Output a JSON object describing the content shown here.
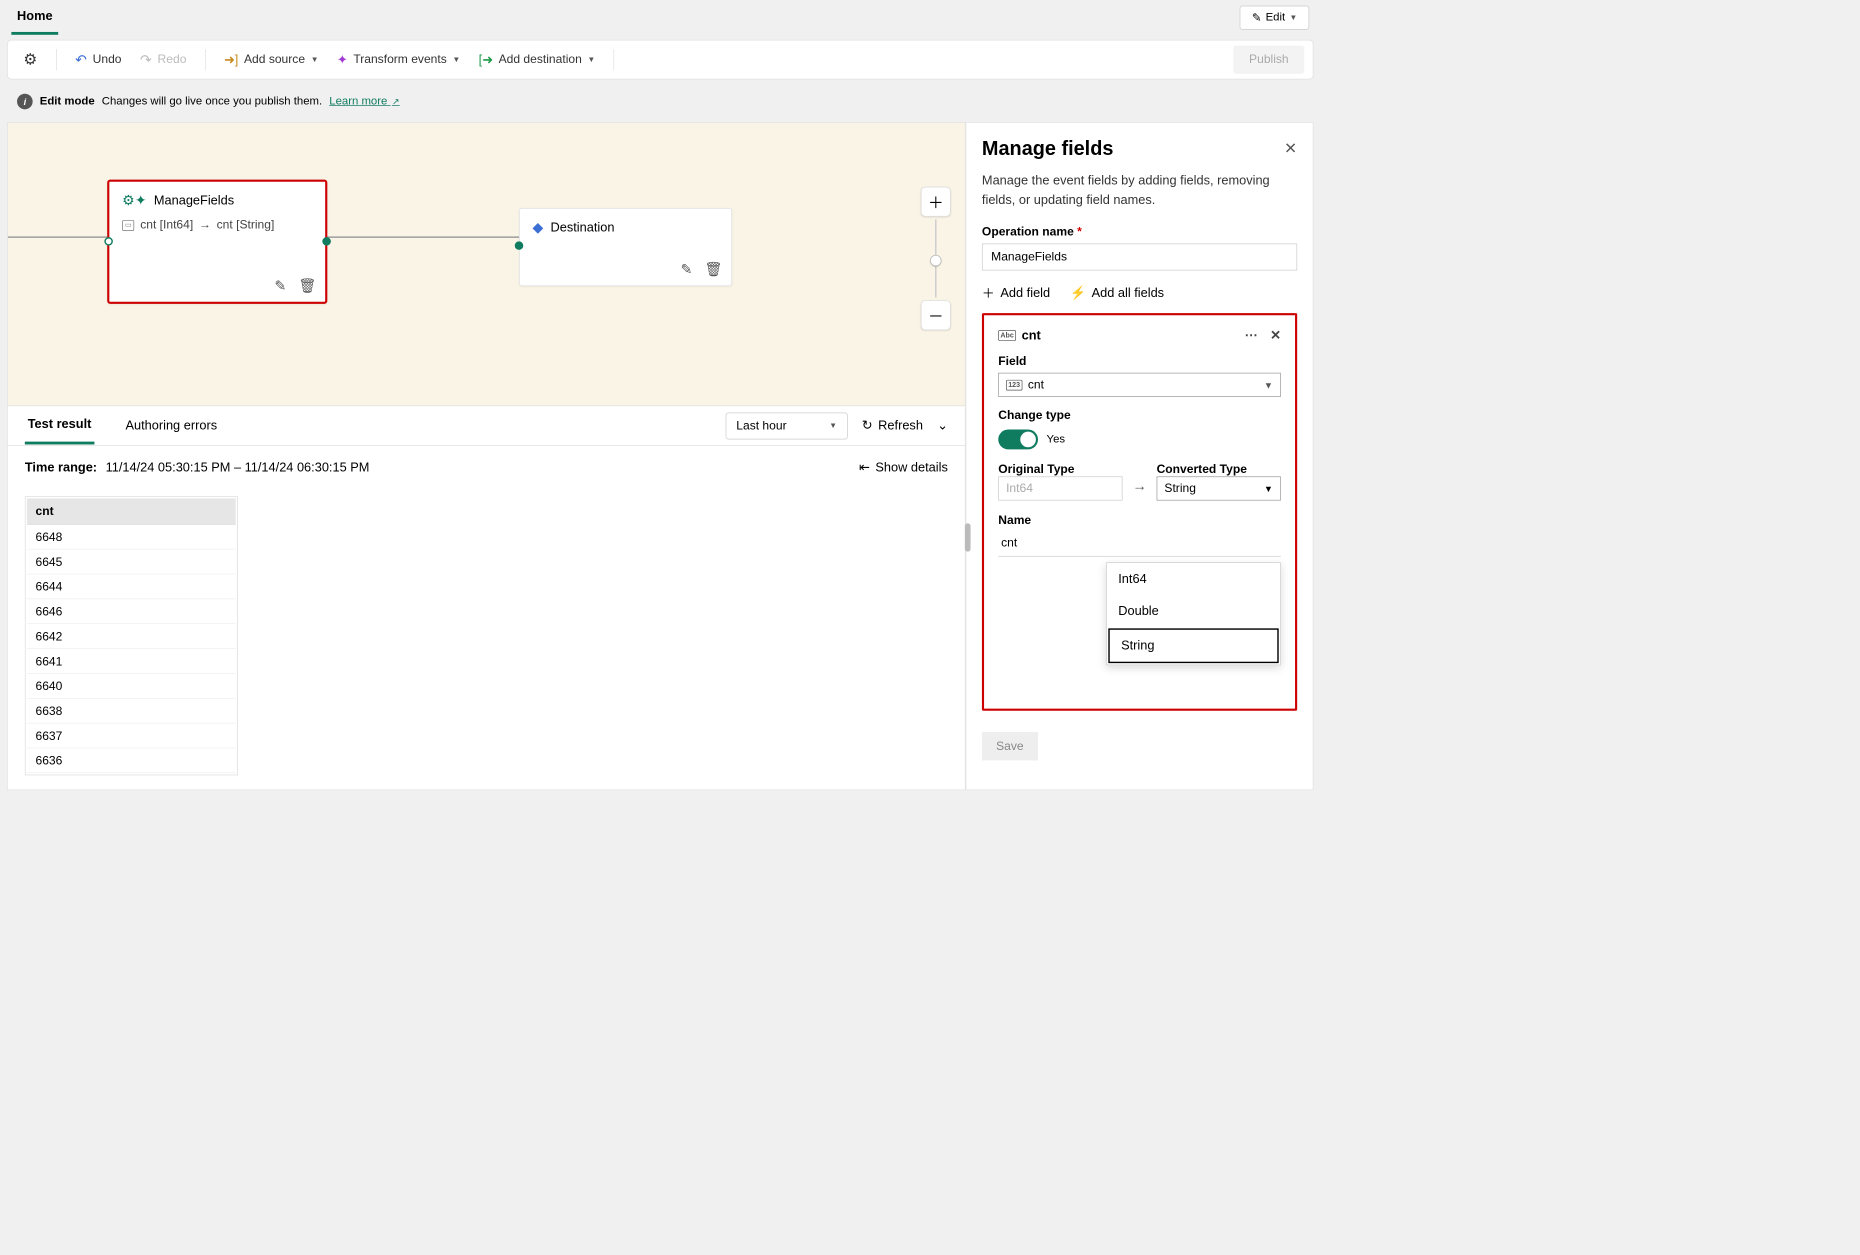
{
  "tabs": {
    "home": "Home",
    "edit": "Edit"
  },
  "toolbar": {
    "undo": "Undo",
    "redo": "Redo",
    "add_source": "Add source",
    "transform": "Transform events",
    "add_dest": "Add destination",
    "publish": "Publish"
  },
  "info": {
    "title": "Edit mode",
    "text": "Changes will go live once you publish them.",
    "link": "Learn more"
  },
  "nodes": {
    "mf_title": "ManageFields",
    "mf_sub_left": "cnt [Int64]",
    "mf_sub_right": "cnt [String]",
    "dest_title": "Destination"
  },
  "bottom": {
    "tab_result": "Test result",
    "tab_errors": "Authoring errors",
    "range_select": "Last hour",
    "refresh": "Refresh",
    "time_label": "Time range:",
    "time_value": "11/14/24 05:30:15 PM  –  11/14/24 06:30:15 PM",
    "show_details": "Show details",
    "col": "cnt",
    "rows": [
      "6648",
      "6645",
      "6644",
      "6646",
      "6642",
      "6641",
      "6640",
      "6638",
      "6637",
      "6636"
    ]
  },
  "panel": {
    "title": "Manage fields",
    "desc": "Manage the event fields by adding fields, removing fields, or updating field names.",
    "op_label": "Operation name",
    "op_value": "ManageFields",
    "add_field": "Add field",
    "add_all": "Add all fields",
    "card": {
      "name": "cnt",
      "field_label": "Field",
      "field_value": "cnt",
      "change_label": "Change type",
      "toggle_text": "Yes",
      "orig_label": "Original Type",
      "orig_value": "Int64",
      "conv_label": "Converted Type",
      "conv_value": "String",
      "name_label": "Name",
      "name_value": "cnt",
      "options": [
        "Int64",
        "Double",
        "String"
      ]
    },
    "save": "Save"
  }
}
